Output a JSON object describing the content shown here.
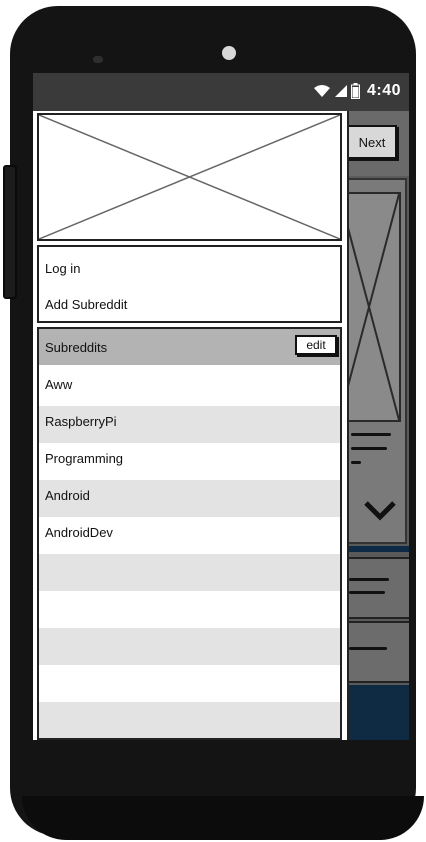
{
  "status_bar": {
    "wifi_icon": "wifi-icon",
    "signal_icon": "signal-icon",
    "battery_icon": "battery-icon",
    "time": "4:40"
  },
  "background_app": {
    "next_label": "Next",
    "expand_icon": "chevron-down-icon"
  },
  "drawer": {
    "header_image": "image-placeholder",
    "account_items": [
      {
        "label": "Log in"
      },
      {
        "label": "Add Subreddit"
      }
    ],
    "subreddits_title": "Subreddits",
    "edit_label": "edit",
    "subreddits": [
      {
        "label": "Aww"
      },
      {
        "label": "RaspberryPi"
      },
      {
        "label": "Programming"
      },
      {
        "label": "Android"
      },
      {
        "label": "AndroidDev"
      },
      {
        "label": ""
      },
      {
        "label": ""
      },
      {
        "label": ""
      },
      {
        "label": ""
      },
      {
        "label": ""
      }
    ]
  },
  "colors": {
    "statusbar": "#3a3a3a",
    "list_header": "#b3b3b3",
    "row_alt": "#e3e3e3",
    "accent_dark": "#0f2b44"
  }
}
